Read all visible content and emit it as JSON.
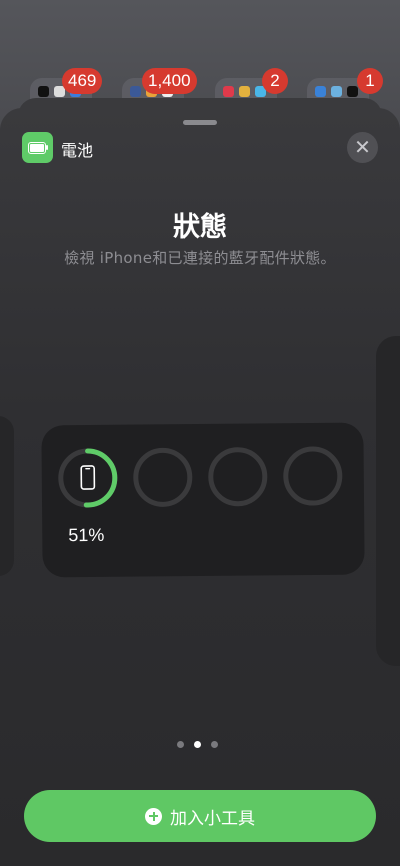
{
  "home_badges": [
    "469",
    "1,400",
    "2",
    "1"
  ],
  "sheet": {
    "app_name": "電池",
    "close_symbol": "✕",
    "title": "狀態",
    "subtitle": "檢視 iPhone和已連接的藍牙配件狀態。",
    "button_label": "加入小工具"
  },
  "widget": {
    "device_percent": "51%",
    "battery_level": 0.51,
    "accent_color": "#5fcb68"
  },
  "pagination": {
    "count": 3,
    "active_index": 1
  }
}
